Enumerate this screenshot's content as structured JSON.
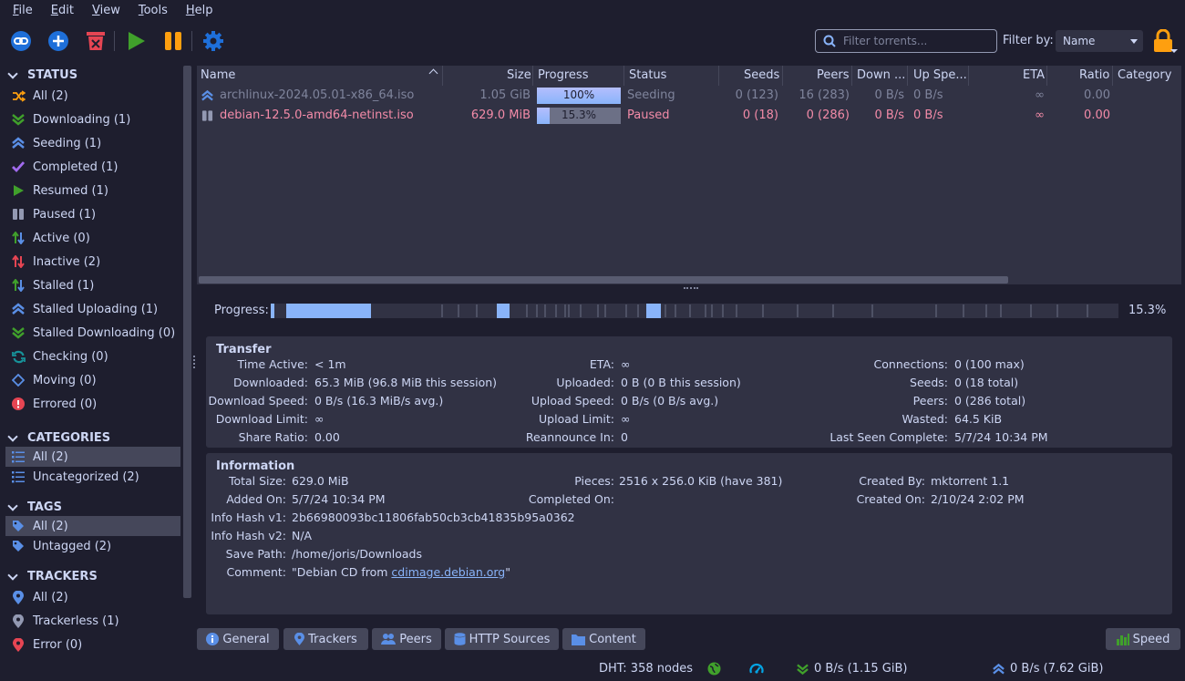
{
  "menu": [
    "File",
    "Edit",
    "View",
    "Tools",
    "Help"
  ],
  "toolbar": {
    "filter_placeholder": "Filter torrents...",
    "filter_by_label": "Filter by:",
    "filter_by_value": "Name"
  },
  "sidebar": {
    "status_header": "STATUS",
    "status_items": [
      {
        "label": "All (2)",
        "icon": "shuffle-icon"
      },
      {
        "label": "Downloading (1)",
        "icon": "download-chevrons-icon"
      },
      {
        "label": "Seeding (1)",
        "icon": "upload-chevrons-icon"
      },
      {
        "label": "Completed (1)",
        "icon": "checkmark-icon"
      },
      {
        "label": "Resumed (1)",
        "icon": "play-icon"
      },
      {
        "label": "Paused (1)",
        "icon": "pause-icon"
      },
      {
        "label": "Active (0)",
        "icon": "active-arrows-icon"
      },
      {
        "label": "Inactive (2)",
        "icon": "inactive-arrows-icon"
      },
      {
        "label": "Stalled (1)",
        "icon": "stalled-arrows-icon"
      },
      {
        "label": "Stalled Uploading (1)",
        "icon": "upload-chevrons-icon"
      },
      {
        "label": "Stalled Downloading (0)",
        "icon": "download-chevrons-icon"
      },
      {
        "label": "Checking (0)",
        "icon": "refresh-icon"
      },
      {
        "label": "Moving (0)",
        "icon": "move-icon"
      },
      {
        "label": "Errored (0)",
        "icon": "error-icon"
      }
    ],
    "categories_header": "CATEGORIES",
    "categories": [
      "All (2)",
      "Uncategorized (2)"
    ],
    "tags_header": "TAGS",
    "tags": [
      "All (2)",
      "Untagged (2)"
    ],
    "trackers_header": "TRACKERS",
    "trackers": [
      "All (2)",
      "Trackerless (1)",
      "Error (0)"
    ]
  },
  "table": {
    "columns": [
      "Name",
      "Size",
      "Progress",
      "Status",
      "Seeds",
      "Peers",
      "Down ...",
      "Up Spe...",
      "ETA",
      "Ratio",
      "Category"
    ],
    "rows": [
      {
        "name": "archlinux-2024.05.01-x86_64.iso",
        "size": "1.05 GiB",
        "progress": "100%",
        "progress_value": 1.0,
        "status": "Seeding",
        "seeds": "0 (123)",
        "peers": "16 (283)",
        "down": "0 B/s",
        "up": "0 B/s",
        "eta": "∞",
        "ratio": "0.00",
        "category": ""
      },
      {
        "name": "debian-12.5.0-amd64-netinst.iso",
        "size": "629.0 MiB",
        "progress": "15.3%",
        "progress_value": 0.153,
        "status": "Paused",
        "seeds": "0 (18)",
        "peers": "0 (286)",
        "down": "0 B/s",
        "up": "0 B/s",
        "eta": "∞",
        "ratio": "0.00",
        "category": ""
      }
    ]
  },
  "progress_strip": {
    "label": "Progress:",
    "percent": "15.3%"
  },
  "transfer": {
    "title": "Transfer",
    "col1": [
      {
        "k": "Time Active:",
        "v": "< 1m"
      },
      {
        "k": "Downloaded:",
        "v": "65.3 MiB (96.8 MiB this session)"
      },
      {
        "k": "Download Speed:",
        "v": "0 B/s (16.3 MiB/s avg.)"
      },
      {
        "k": "Download Limit:",
        "v": "∞"
      },
      {
        "k": "Share Ratio:",
        "v": "0.00"
      }
    ],
    "col2": [
      {
        "k": "ETA:",
        "v": "∞"
      },
      {
        "k": "Uploaded:",
        "v": "0 B (0 B this session)"
      },
      {
        "k": "Upload Speed:",
        "v": "0 B/s (0 B/s avg.)"
      },
      {
        "k": "Upload Limit:",
        "v": "∞"
      },
      {
        "k": "Reannounce In:",
        "v": "0"
      }
    ],
    "col3": [
      {
        "k": "Connections:",
        "v": "0 (100 max)"
      },
      {
        "k": "Seeds:",
        "v": "0 (18 total)"
      },
      {
        "k": "Peers:",
        "v": "0 (286 total)"
      },
      {
        "k": "Wasted:",
        "v": "64.5 KiB"
      },
      {
        "k": "Last Seen Complete:",
        "v": "5/7/24 10:34 PM"
      }
    ]
  },
  "information": {
    "title": "Information",
    "total_size_k": "Total Size:",
    "total_size_v": "629.0 MiB",
    "added_on_k": "Added On:",
    "added_on_v": "5/7/24 10:34 PM",
    "hash1_k": "Info Hash v1:",
    "hash1_v": "2b66980093bc11806fab50cb3cb41835b95a0362",
    "hash2_k": "Info Hash v2:",
    "hash2_v": "N/A",
    "save_path_k": "Save Path:",
    "save_path_v": "/home/joris/Downloads",
    "comment_k": "Comment:",
    "comment_prefix": "\"Debian CD from ",
    "comment_link": "cdimage.debian.org",
    "comment_suffix": "\"",
    "pieces_k": "Pieces:",
    "pieces_v": "2516 x 256.0 KiB (have 381)",
    "completed_on_k": "Completed On:",
    "completed_on_v": "",
    "created_by_k": "Created By:",
    "created_by_v": "mktorrent 1.1",
    "created_on_k": "Created On:",
    "created_on_v": "2/10/24 2:02 PM"
  },
  "tabs": [
    "General",
    "Trackers",
    "Peers",
    "HTTP Sources",
    "Content"
  ],
  "speed_button": "Speed",
  "status_bar": {
    "dht": "DHT: 358 nodes",
    "down": "0 B/s (1.15 GiB)",
    "up": "0 B/s (7.62 GiB)"
  },
  "colors": {
    "background": "#1e1e2e",
    "panel": "#313244",
    "accent_blue": "#89b4fa",
    "green": "#40a02b",
    "red": "#e64553",
    "orange": "#fe9f0f",
    "paused_text": "#f38ba8"
  }
}
